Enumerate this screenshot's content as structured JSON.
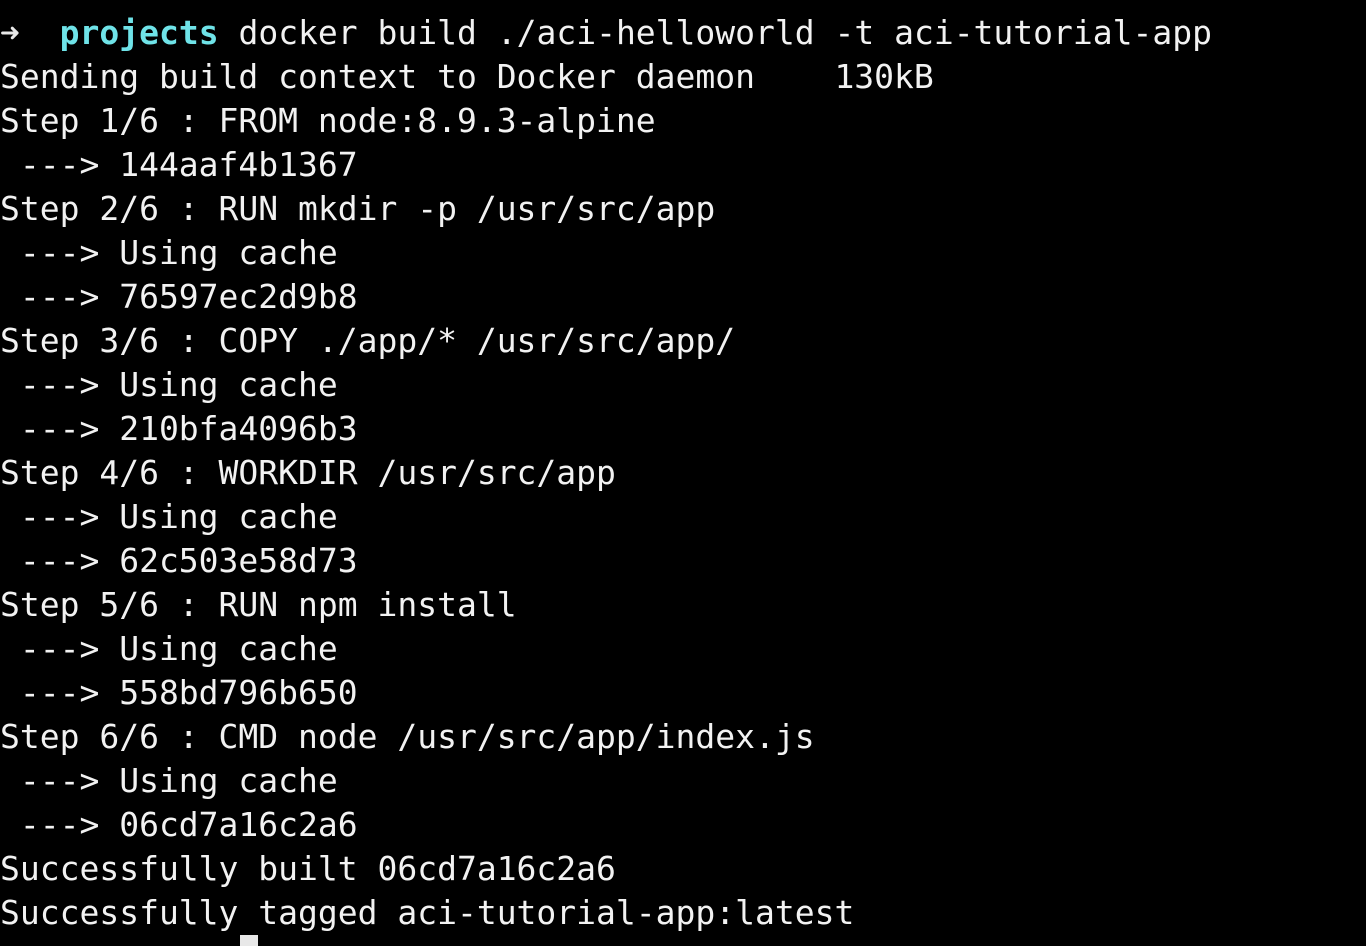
{
  "terminal": {
    "prompt_arrow": "➜",
    "prompt_dir": "projects",
    "command": "docker build ./aci-helloworld -t aci-tutorial-app",
    "lines": [
      "Sending build context to Docker daemon    130kB",
      "Step 1/6 : FROM node:8.9.3-alpine",
      " ---> 144aaf4b1367",
      "Step 2/6 : RUN mkdir -p /usr/src/app",
      " ---> Using cache",
      " ---> 76597ec2d9b8",
      "Step 3/6 : COPY ./app/* /usr/src/app/",
      " ---> Using cache",
      " ---> 210bfa4096b3",
      "Step 4/6 : WORKDIR /usr/src/app",
      " ---> Using cache",
      " ---> 62c503e58d73",
      "Step 5/6 : RUN npm install",
      " ---> Using cache",
      " ---> 558bd796b650",
      "Step 6/6 : CMD node /usr/src/app/index.js",
      " ---> Using cache",
      " ---> 06cd7a16c2a6",
      "Successfully built 06cd7a16c2a6",
      "Successfully tagged aci-tutorial-app:latest"
    ]
  },
  "colors": {
    "background": "#000000",
    "text": "#f2f2f2",
    "prompt_dir": "#6fe3e8"
  }
}
